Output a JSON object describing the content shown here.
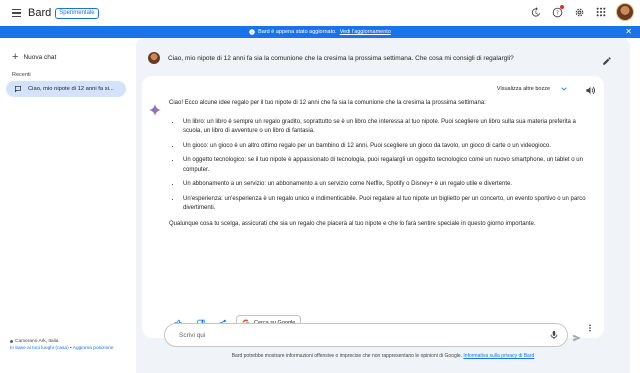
{
  "app": {
    "brand": "Bard",
    "badge": "Sperimentale"
  },
  "banner": {
    "message": "Bard è appena stato aggiornato.",
    "link": "Vedi l'aggiornamento"
  },
  "sidebar": {
    "new_chat": "Nuova chat",
    "recent_label": "Recenti",
    "recent_items": [
      {
        "label": "Ciao, mio nipote di 12 anni fa si..."
      }
    ],
    "location": {
      "place": "Camerano Ark, Italia",
      "link1": "In base ai tuoi luoghi (casa)",
      "separator": " • ",
      "link2": "Aggiorna posizione"
    }
  },
  "conversation": {
    "prompt": "Ciao, mio nipote di 12 anni fa sia la comunione che la cresima la prossima settimana. Che cosa mi consigli di regalargli?",
    "drafts_label": "Visualizza altre bozze",
    "response_intro": "Ciao! Ecco alcune idee regalo per il tuo nipote di 12 anni che fa sia la comunione che la cresima la prossima settimana:",
    "bullets": [
      "Un libro: un libro è sempre un regalo gradito, soprattutto se è un libro che interessa al tuo nipote. Puoi scegliere un libro sulla sua materia preferita a scuola, un libro di avventure o un libro di fantasia.",
      "Un gioco: un gioco è un altro ottimo regalo per un bambino di 12 anni. Puoi scegliere un gioco da tavolo, un gioco di carte o un videogioco.",
      "Un oggetto tecnologico: se il tuo nipote è appassionato di tecnologia, puoi regalargli un oggetto tecnologico come un nuovo smartphone, un tablet o un computer.",
      "Un abbonamento a un servizio: un abbonamento a un servizio come Netflix, Spotify o Disney+ è un regalo utile e divertente.",
      "Un'esperienza: un'esperienza è un regalo unico e indimenticabile. Puoi regalare al tuo nipote un biglietto per un concerto, un evento sportivo o un parco divertimenti."
    ],
    "response_closing": "Qualunque cosa tu scelga, assicurati che sia un regalo che piacerà al tuo nipote e che lo farà sentire speciale in questo giorno importante.",
    "google_button": "Cerca su Google"
  },
  "input": {
    "placeholder": "Scrivi qui"
  },
  "disclaimer": {
    "text": "Bard potrebbe mostrare informazioni offensive o imprecise che non rappresentano le opinioni di Google.",
    "link": "Informativa sulla privacy di Bard"
  },
  "colors": {
    "accent": "#1a73e8",
    "main_bg": "#f0f4f9",
    "selected_item": "#d3e3fd"
  }
}
